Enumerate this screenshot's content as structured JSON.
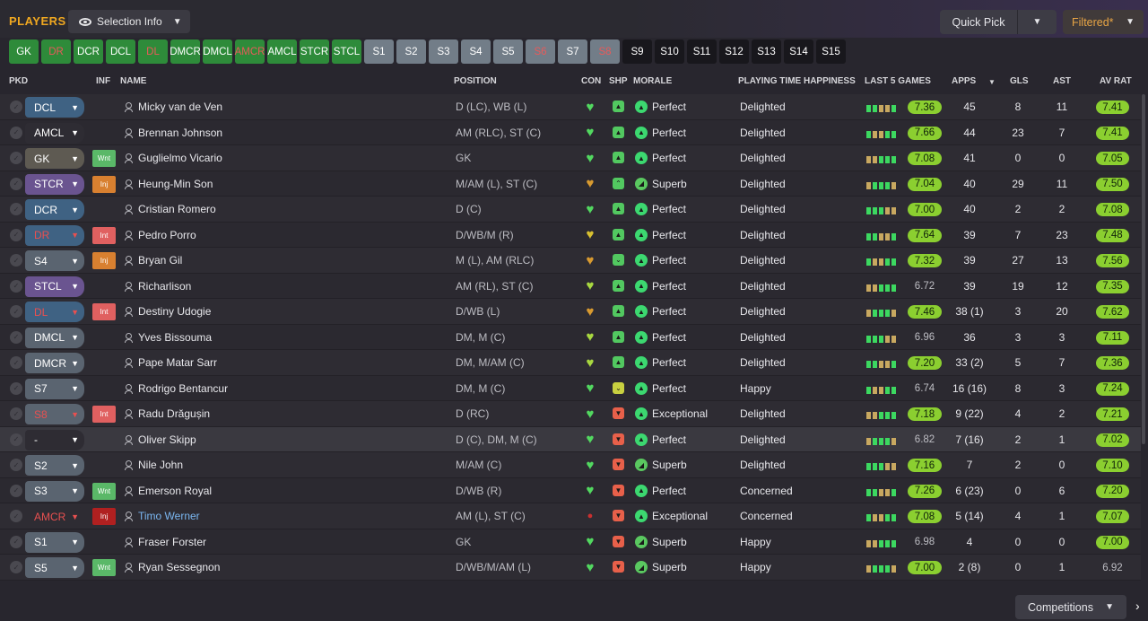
{
  "header": {
    "title": "PLAYERS",
    "selection_info": "Selection Info",
    "quick_pick": "Quick Pick",
    "filtered": "Filtered*"
  },
  "position_buttons": [
    {
      "label": "GK",
      "style": "green"
    },
    {
      "label": "DR",
      "style": "green",
      "text_color": "red"
    },
    {
      "label": "DCR",
      "style": "green"
    },
    {
      "label": "DCL",
      "style": "green"
    },
    {
      "label": "DL",
      "style": "green",
      "text_color": "red"
    },
    {
      "label": "DMCR",
      "style": "green"
    },
    {
      "label": "DMCL",
      "style": "green"
    },
    {
      "label": "AMCR",
      "style": "green",
      "text_color": "red"
    },
    {
      "label": "AMCL",
      "style": "green"
    },
    {
      "label": "STCR",
      "style": "green"
    },
    {
      "label": "STCL",
      "style": "green"
    },
    {
      "label": "S1",
      "style": "grey"
    },
    {
      "label": "S2",
      "style": "grey"
    },
    {
      "label": "S3",
      "style": "grey"
    },
    {
      "label": "S4",
      "style": "grey"
    },
    {
      "label": "S5",
      "style": "grey"
    },
    {
      "label": "S6",
      "style": "grey",
      "text_color": "red"
    },
    {
      "label": "S7",
      "style": "grey"
    },
    {
      "label": "S8",
      "style": "grey",
      "text_color": "red"
    },
    {
      "label": "S9",
      "style": "dark"
    },
    {
      "label": "S10",
      "style": "dark"
    },
    {
      "label": "S11",
      "style": "dark"
    },
    {
      "label": "S12",
      "style": "dark"
    },
    {
      "label": "S13",
      "style": "dark"
    },
    {
      "label": "S14",
      "style": "dark"
    },
    {
      "label": "S15",
      "style": "dark"
    }
  ],
  "columns": {
    "pkd": "PKD",
    "inf": "INF",
    "name": "NAME",
    "position": "POSITION",
    "con": "CON",
    "shp": "SHP",
    "morale": "MORALE",
    "pth": "PLAYING TIME HAPPINESS",
    "last5": "LAST 5 GAMES",
    "apps": "APPS",
    "gls": "GLS",
    "ast": "AST",
    "avrat": "AV RAT"
  },
  "players": [
    {
      "pick": "DCL",
      "pick_color": "#3f6283",
      "inf": "",
      "name": "Micky van de Ven",
      "position": "D (LC), WB (L)",
      "con": "green",
      "shp": "green",
      "morale_icon": "perfect",
      "morale": "Perfect",
      "pth": "Delighted",
      "last5_rating": "7.36",
      "apps": "45",
      "gls": "8",
      "ast": "11",
      "avrat": "7.41",
      "avrat_good": true
    },
    {
      "pick": "AMCL",
      "pick_color": "#2e2c33",
      "inf": "",
      "name": "Brennan Johnson",
      "position": "AM (RLC), ST (C)",
      "con": "green",
      "shp": "green",
      "morale_icon": "perfect",
      "morale": "Perfect",
      "pth": "Delighted",
      "last5_rating": "7.66",
      "apps": "44",
      "gls": "23",
      "ast": "7",
      "avrat": "7.41",
      "avrat_good": true
    },
    {
      "pick": "GK",
      "pick_color": "#5e5a52",
      "inf": "Wnt",
      "inf_color": "#5ab868",
      "name": "Guglielmo Vicario",
      "position": "GK",
      "con": "green",
      "shp": "green",
      "morale_icon": "perfect",
      "morale": "Perfect",
      "pth": "Delighted",
      "last5_rating": "7.08",
      "apps": "41",
      "gls": "0",
      "ast": "0",
      "avrat": "7.05",
      "avrat_good": true
    },
    {
      "pick": "STCR",
      "pick_color": "#6a5490",
      "inf": "Inj",
      "inf_color": "#d88030",
      "name": "Heung-Min Son",
      "position": "M/AM (L), ST (C)",
      "con": "orange",
      "shp": "green-up",
      "morale_icon": "superb",
      "morale": "Superb",
      "pth": "Delighted",
      "last5_rating": "7.04",
      "apps": "40",
      "gls": "29",
      "ast": "11",
      "avrat": "7.50",
      "avrat_good": true
    },
    {
      "pick": "DCR",
      "pick_color": "#3f6283",
      "inf": "",
      "name": "Cristian Romero",
      "position": "D (C)",
      "con": "green",
      "shp": "green",
      "morale_icon": "perfect",
      "morale": "Perfect",
      "pth": "Delighted",
      "last5_rating": "7.00",
      "apps": "40",
      "gls": "2",
      "ast": "2",
      "avrat": "7.08",
      "avrat_good": true
    },
    {
      "pick": "DR",
      "pick_color": "#3f6283",
      "pick_text": "red",
      "inf": "Int",
      "inf_color": "#e06060",
      "name": "Pedro Porro",
      "position": "D/WB/M (R)",
      "con": "yellow",
      "shp": "green",
      "morale_icon": "perfect",
      "morale": "Perfect",
      "pth": "Delighted",
      "last5_rating": "7.64",
      "apps": "39",
      "gls": "7",
      "ast": "23",
      "avrat": "7.48",
      "avrat_good": true
    },
    {
      "pick": "S4",
      "pick_color": "#5a6470",
      "inf": "Inj",
      "inf_color": "#d88030",
      "name": "Bryan Gil",
      "position": "M (L), AM (RLC)",
      "con": "orange",
      "shp": "green-down",
      "morale_icon": "perfect",
      "morale": "Perfect",
      "pth": "Delighted",
      "last5_rating": "7.32",
      "apps": "39",
      "gls": "27",
      "ast": "13",
      "avrat": "7.56",
      "avrat_good": true
    },
    {
      "pick": "STCL",
      "pick_color": "#6a5490",
      "inf": "",
      "name": "Richarlison",
      "position": "AM (RL), ST (C)",
      "con": "lime",
      "shp": "green",
      "morale_icon": "perfect",
      "morale": "Perfect",
      "pth": "Delighted",
      "last5_rating": "6.72",
      "apps": "39",
      "gls": "19",
      "ast": "12",
      "avrat": "7.35",
      "avrat_good": true
    },
    {
      "pick": "DL",
      "pick_color": "#3f6283",
      "pick_text": "red",
      "inf": "Int",
      "inf_color": "#e06060",
      "name": "Destiny Udogie",
      "position": "D/WB (L)",
      "con": "orange",
      "shp": "green",
      "morale_icon": "perfect",
      "morale": "Perfect",
      "pth": "Delighted",
      "last5_rating": "7.46",
      "apps": "38 (1)",
      "gls": "3",
      "ast": "20",
      "avrat": "7.62",
      "avrat_good": true
    },
    {
      "pick": "DMCL",
      "pick_color": "#5a6470",
      "inf": "",
      "name": "Yves Bissouma",
      "position": "DM, M (C)",
      "con": "lime",
      "shp": "green",
      "morale_icon": "perfect",
      "morale": "Perfect",
      "pth": "Delighted",
      "last5_rating": "6.96",
      "apps": "36",
      "gls": "3",
      "ast": "3",
      "avrat": "7.11",
      "avrat_good": true
    },
    {
      "pick": "DMCR",
      "pick_color": "#5a6470",
      "inf": "",
      "name": "Pape Matar Sarr",
      "position": "DM, M/AM (C)",
      "con": "lime",
      "shp": "green",
      "morale_icon": "perfect",
      "morale": "Perfect",
      "pth": "Delighted",
      "last5_rating": "7.20",
      "apps": "33 (2)",
      "gls": "5",
      "ast": "7",
      "avrat": "7.36",
      "avrat_good": true
    },
    {
      "pick": "S7",
      "pick_color": "#5a6470",
      "inf": "",
      "name": "Rodrigo Bentancur",
      "position": "DM, M (C)",
      "con": "green",
      "shp": "yellow",
      "morale_icon": "perfect",
      "morale": "Perfect",
      "pth": "Happy",
      "last5_rating": "6.74",
      "apps": "16 (16)",
      "gls": "8",
      "ast": "3",
      "avrat": "7.24",
      "avrat_good": true
    },
    {
      "pick": "S8",
      "pick_color": "#5a6470",
      "pick_text": "red",
      "inf": "Int",
      "inf_color": "#e06060",
      "name": "Radu Drăgușin",
      "position": "D (RC)",
      "con": "green",
      "shp": "red",
      "morale_icon": "perfect",
      "morale": "Exceptional",
      "pth": "Delighted",
      "last5_rating": "7.18",
      "apps": "9 (22)",
      "gls": "4",
      "ast": "2",
      "avrat": "7.21",
      "avrat_good": true
    },
    {
      "pick": "-",
      "pick_color": "#2e2c33",
      "inf": "",
      "name": "Oliver Skipp",
      "position": "D (C), DM, M (C)",
      "con": "green",
      "shp": "red",
      "morale_icon": "perfect",
      "morale": "Perfect",
      "pth": "Delighted",
      "last5_rating": "6.82",
      "apps": "7 (16)",
      "gls": "2",
      "ast": "1",
      "avrat": "7.02",
      "avrat_good": true,
      "highlight": true
    },
    {
      "pick": "S2",
      "pick_color": "#5a6470",
      "inf": "",
      "name": "Nile John",
      "position": "M/AM (C)",
      "con": "green",
      "shp": "red",
      "morale_icon": "superb",
      "morale": "Superb",
      "pth": "Delighted",
      "last5_rating": "7.16",
      "apps": "7",
      "gls": "2",
      "ast": "0",
      "avrat": "7.10",
      "avrat_good": true
    },
    {
      "pick": "S3",
      "pick_color": "#5a6470",
      "inf": "Wnt",
      "inf_color": "#5ab868",
      "name": "Emerson Royal",
      "position": "D/WB (R)",
      "con": "green",
      "shp": "red",
      "morale_icon": "perfect",
      "morale": "Perfect",
      "pth": "Concerned",
      "last5_rating": "7.26",
      "apps": "6 (23)",
      "gls": "0",
      "ast": "6",
      "avrat": "7.20",
      "avrat_good": true
    },
    {
      "pick": "AMCR",
      "pick_color": "#2e2c33",
      "pick_text": "red",
      "inf": "Inj",
      "inf_color": "#b02020",
      "name": "Timo Werner",
      "name_link": true,
      "position": "AM (L), ST (C)",
      "con": "red-dot",
      "shp": "red",
      "morale_icon": "perfect",
      "morale": "Exceptional",
      "pth": "Concerned",
      "last5_rating": "7.08",
      "apps": "5 (14)",
      "gls": "4",
      "ast": "1",
      "avrat": "7.07",
      "avrat_good": true
    },
    {
      "pick": "S1",
      "pick_color": "#5a6470",
      "inf": "",
      "name": "Fraser Forster",
      "position": "GK",
      "con": "green",
      "shp": "red",
      "morale_icon": "superb",
      "morale": "Superb",
      "pth": "Happy",
      "last5_rating": "6.98",
      "apps": "4",
      "gls": "0",
      "ast": "0",
      "avrat": "7.00",
      "avrat_good": true
    },
    {
      "pick": "S5",
      "pick_color": "#5a6470",
      "inf": "Wnt",
      "inf_color": "#5ab868",
      "name": "Ryan Sessegnon",
      "position": "D/WB/M/AM (L)",
      "con": "green",
      "shp": "red",
      "morale_icon": "superb",
      "morale": "Superb",
      "pth": "Happy",
      "last5_rating": "7.00",
      "apps": "2 (8)",
      "gls": "0",
      "ast": "1",
      "avrat": "6.92",
      "avrat_good": false
    }
  ],
  "footer": {
    "competitions": "Competitions"
  },
  "colors": {
    "accent": "#f0a820",
    "rating_good": "#8bcf30",
    "green": "#2e8b3a",
    "grey": "#727d88"
  }
}
